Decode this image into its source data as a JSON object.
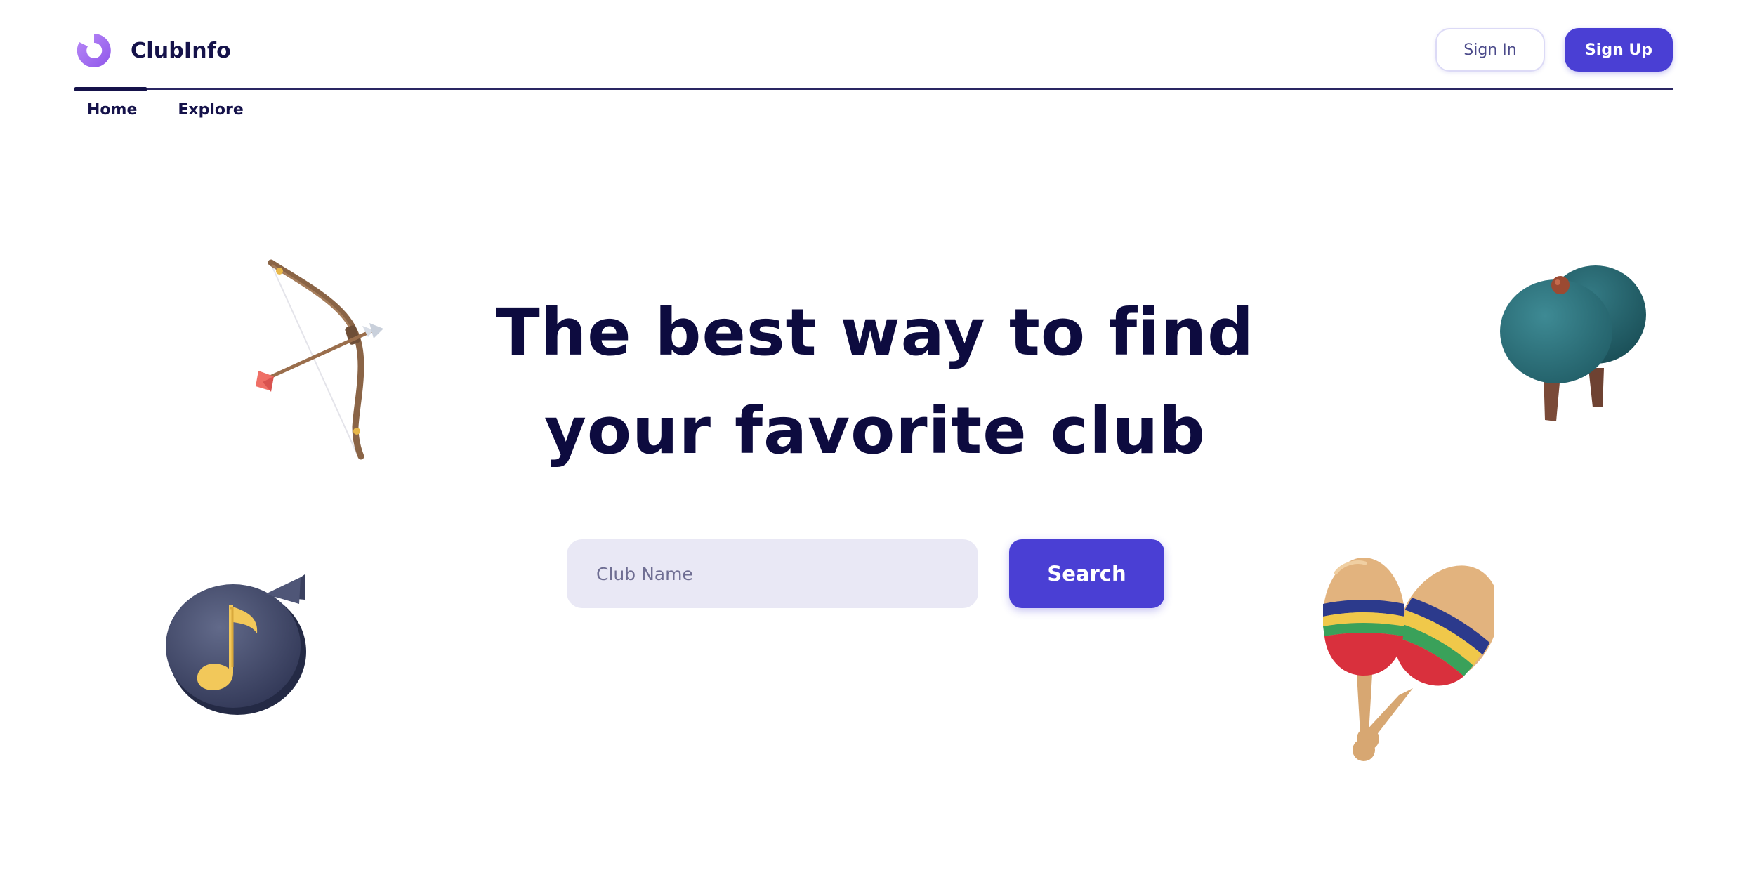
{
  "app": {
    "name": "ClubInfo",
    "logo_icon": "ring-logo-icon",
    "accent_color": "#4a3fd4",
    "logo_color": "#a36cf0",
    "text_color": "#0d0b3f"
  },
  "header": {
    "sign_in_label": "Sign In",
    "sign_up_label": "Sign Up"
  },
  "nav": {
    "items": [
      {
        "label": "Home",
        "active": true
      },
      {
        "label": "Explore",
        "active": false
      }
    ]
  },
  "hero": {
    "title_line1": "The best way to find",
    "title_line2": "your favorite club"
  },
  "search": {
    "placeholder": "Club Name",
    "value": "",
    "button_label": "Search"
  },
  "decorations": [
    {
      "icon": "bow-and-arrow-icon"
    },
    {
      "icon": "music-note-bubble-icon"
    },
    {
      "icon": "ping-pong-paddles-icon"
    },
    {
      "icon": "maracas-icon"
    }
  ]
}
